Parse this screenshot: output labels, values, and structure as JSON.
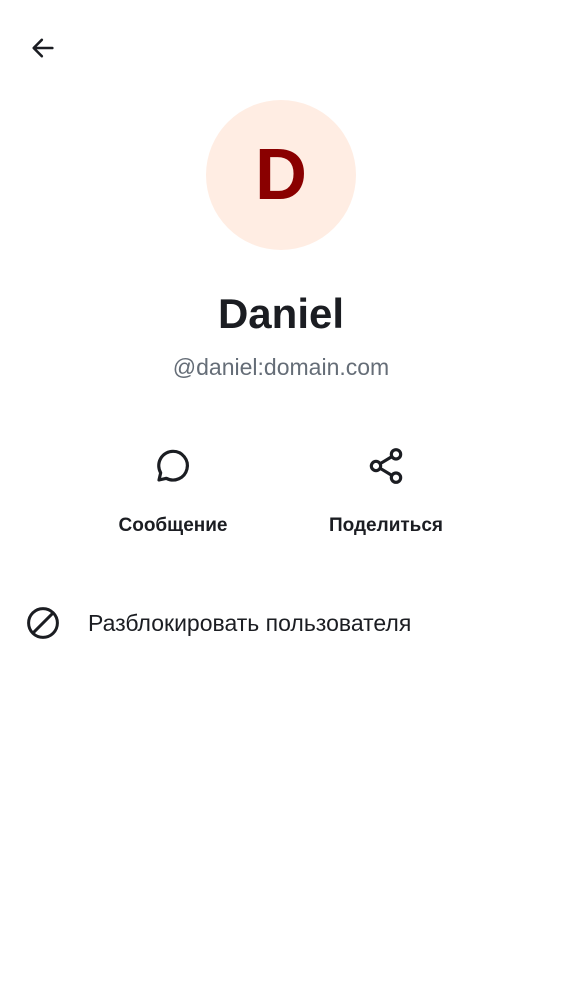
{
  "colors": {
    "avatar_background": "#ffede3",
    "avatar_initial": "#8a0000",
    "text_primary": "#1b1d22",
    "text_secondary": "#656d77"
  },
  "header": {
    "back_icon": "arrow-left-icon"
  },
  "profile": {
    "avatar_initial": "D",
    "display_name": "Daniel",
    "user_id": "@daniel:domain.com"
  },
  "actions": [
    {
      "icon": "chat-bubble-icon",
      "label": "Сообщение"
    },
    {
      "icon": "share-icon",
      "label": "Поделиться"
    }
  ],
  "unblock": {
    "icon": "block-icon",
    "label": "Разблокировать пользователя"
  }
}
